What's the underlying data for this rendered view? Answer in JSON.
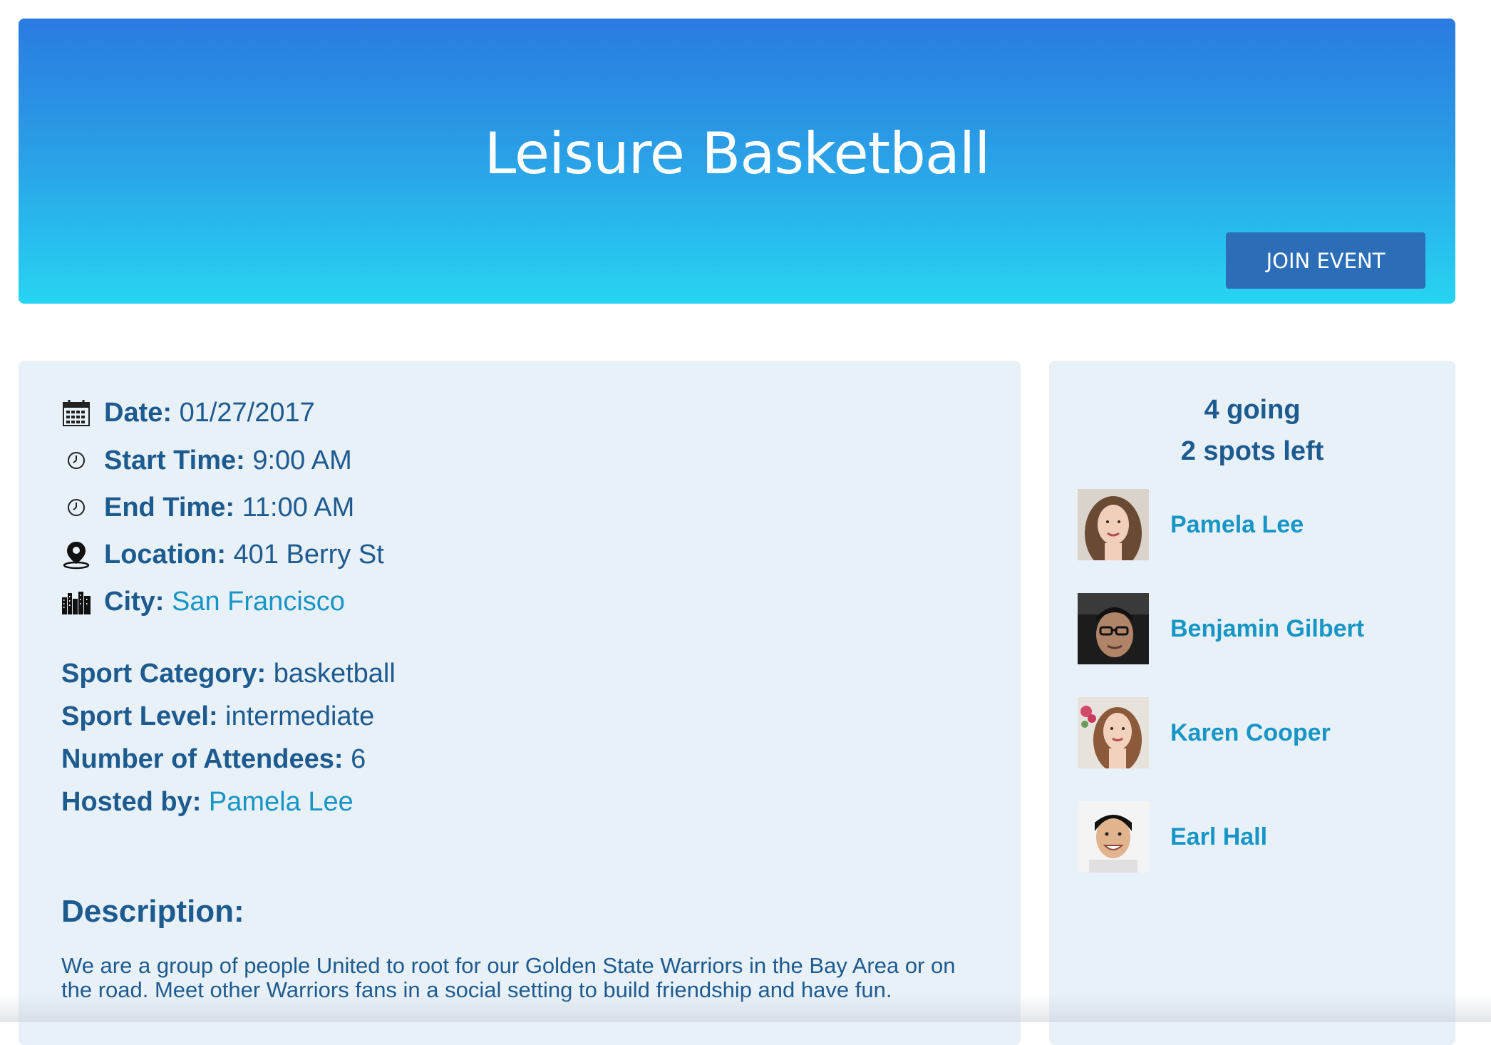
{
  "event": {
    "title": "Leisure Basketball",
    "join_label": "JOIN EVENT"
  },
  "details": {
    "date_label": "Date:",
    "date_value": "01/27/2017",
    "start_label": "Start Time:",
    "start_value": "9:00 AM",
    "end_label": "End Time:",
    "end_value": "11:00 AM",
    "location_label": "Location:",
    "location_value": "401 Berry St",
    "city_label": "City:",
    "city_value": "San Francisco",
    "category_label": "Sport Category:",
    "category_value": "basketball",
    "level_label": "Sport Level:",
    "level_value": "intermediate",
    "attendees_label": "Number of Attendees:",
    "attendees_value": "6",
    "host_label": "Hosted by:",
    "host_value": "Pamela Lee",
    "description_heading": "Description:",
    "description_text": "We are a group of people United to root for our Golden State Warriors in the Bay Area or on the road. Meet other Warriors fans in a social setting to build friendship and have fun."
  },
  "attendance": {
    "going": "4 going",
    "spots_left": "2 spots left",
    "attendees": [
      {
        "name": "Pamela Lee"
      },
      {
        "name": "Benjamin Gilbert"
      },
      {
        "name": "Karen Cooper"
      },
      {
        "name": "Earl Hall"
      }
    ]
  },
  "colors": {
    "hero_top": "#2a7be0",
    "hero_bottom": "#27d4f2",
    "button": "#2c6db8",
    "text": "#1d5b8f",
    "link": "#1796c6",
    "card": "#e8f0f8"
  },
  "icons": [
    "calendar-icon",
    "clock-icon",
    "location-pin-icon",
    "city-icon"
  ]
}
